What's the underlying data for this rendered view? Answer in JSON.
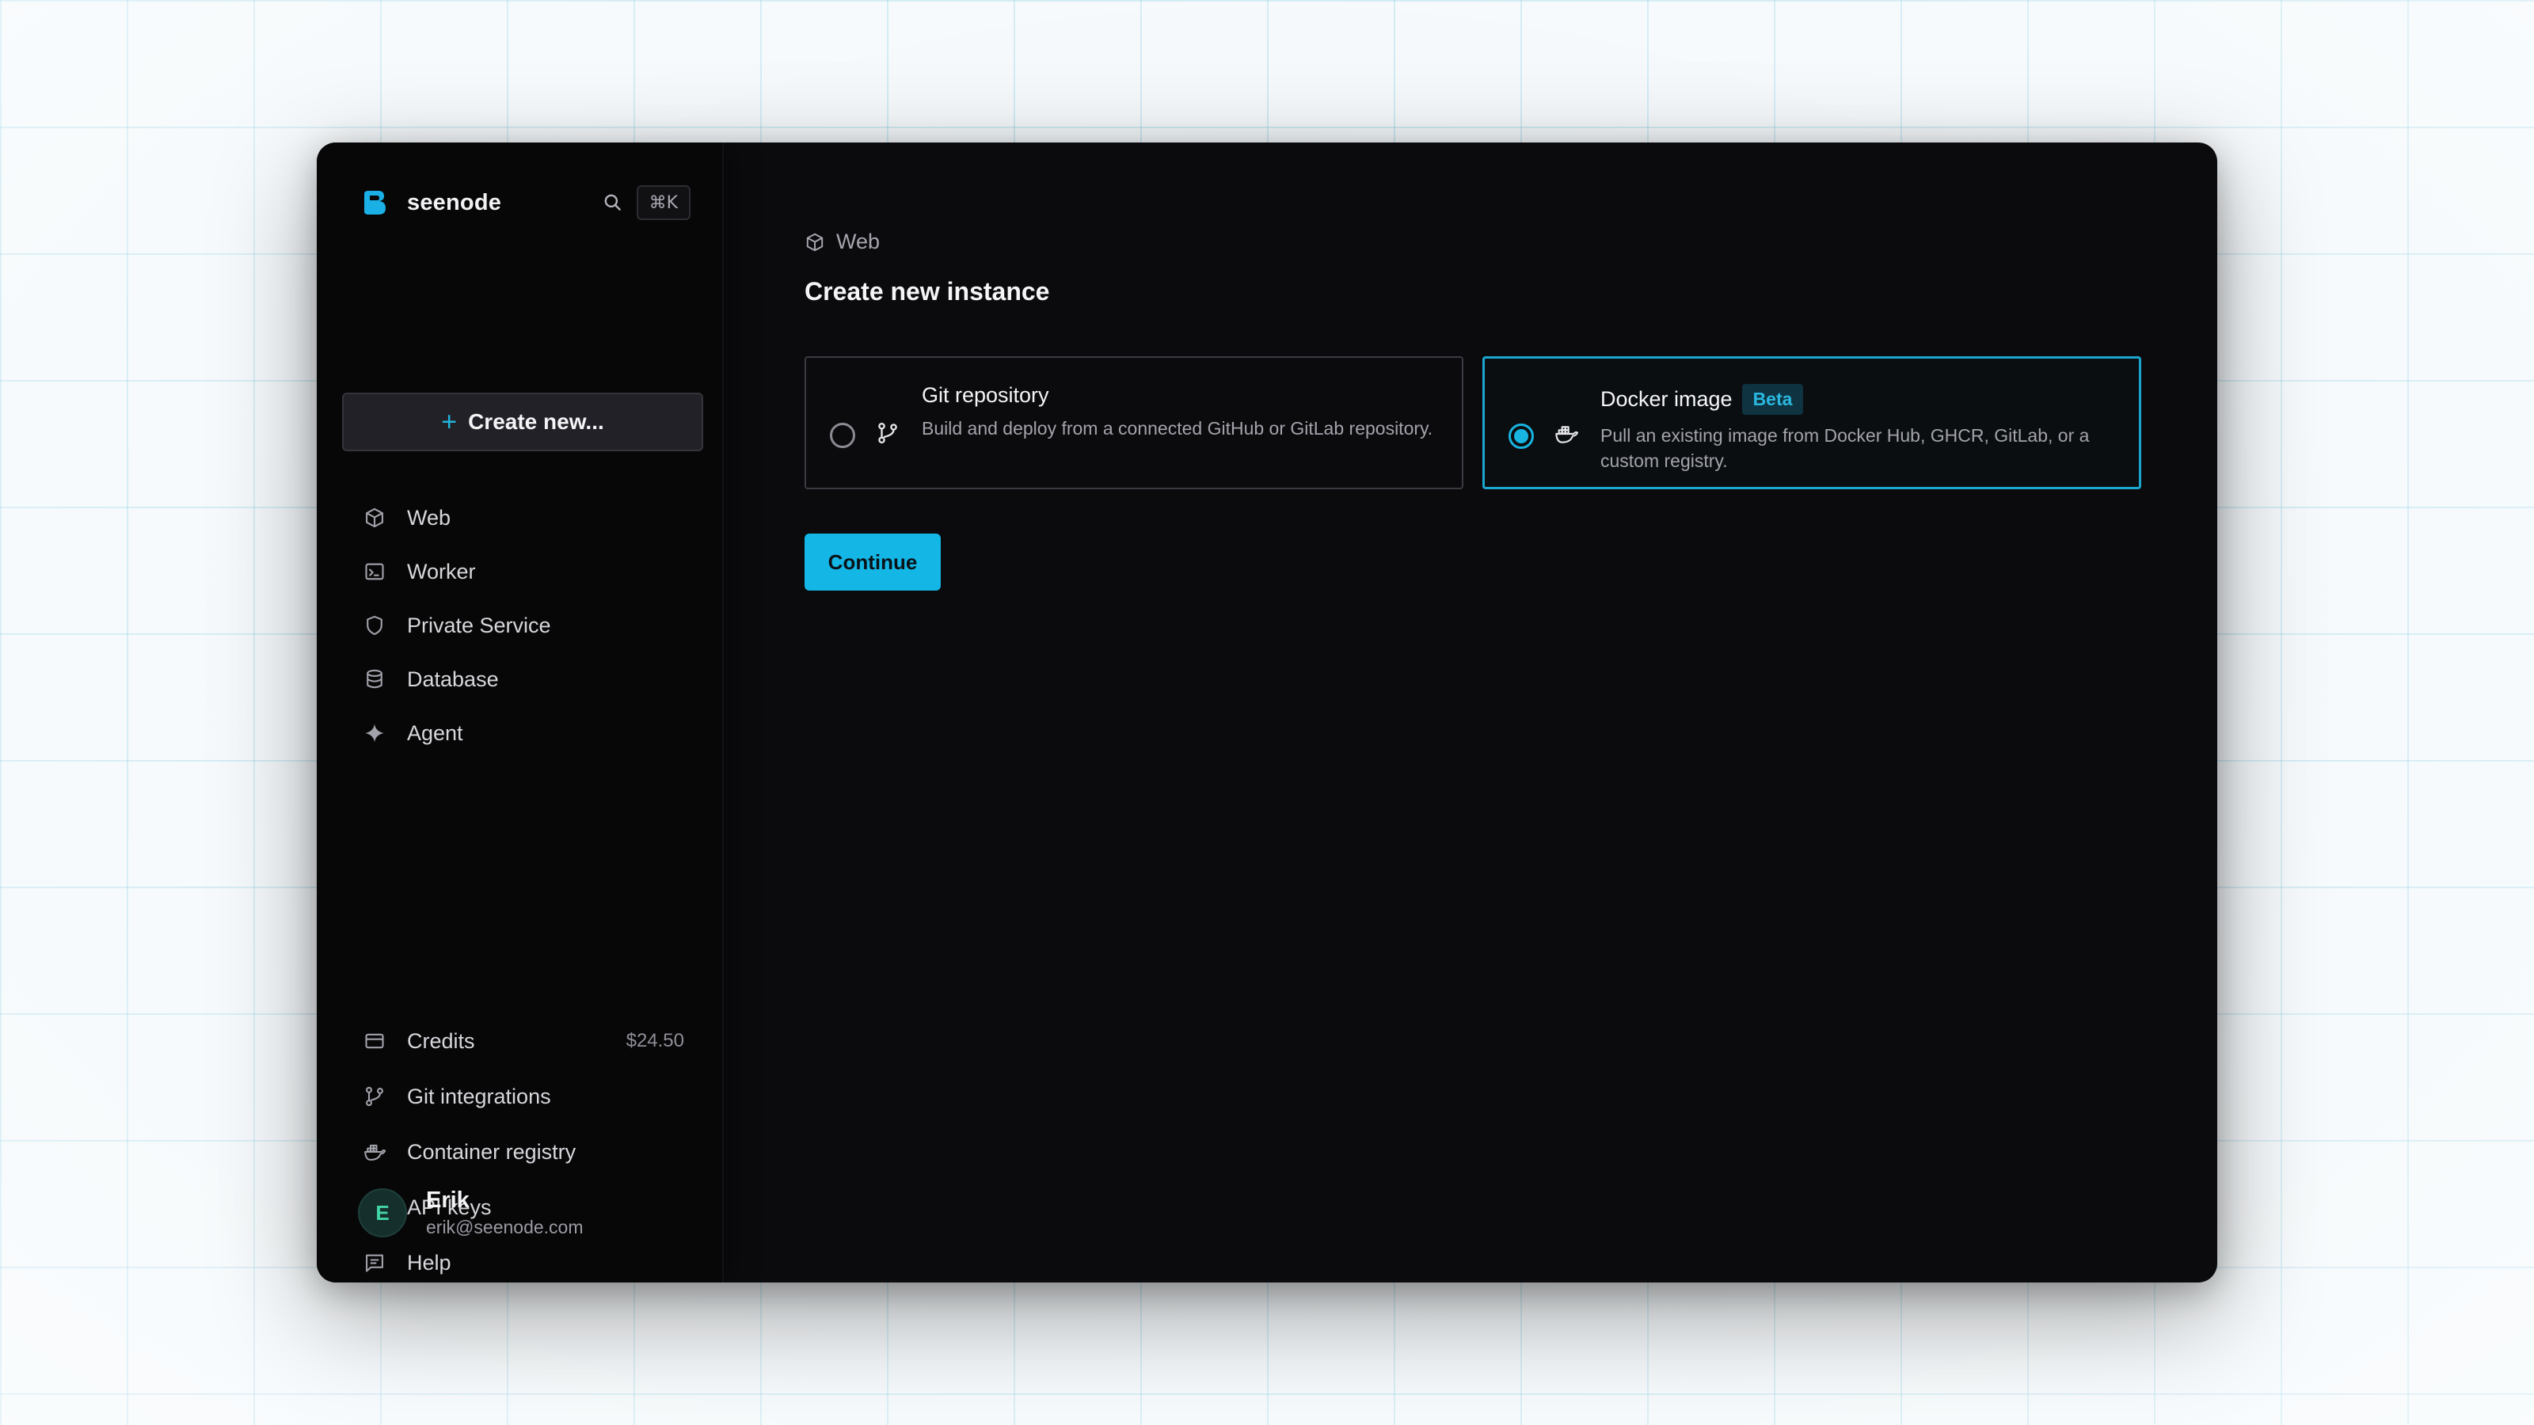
{
  "brand": {
    "name": "seenode",
    "shortcut": "⌘K"
  },
  "sidebar": {
    "create_label": "Create new...",
    "create_icon": "+",
    "items": [
      {
        "label": "Web",
        "icon": "cube-icon"
      },
      {
        "label": "Worker",
        "icon": "terminal-icon"
      },
      {
        "label": "Private Service",
        "icon": "shield-icon"
      },
      {
        "label": "Database",
        "icon": "database-icon"
      },
      {
        "label": "Agent",
        "icon": "sparkle-icon"
      }
    ],
    "bottom_items": [
      {
        "label": "Credits",
        "meta": "$24.50",
        "icon": "credit-card-icon"
      },
      {
        "label": "Git integrations",
        "icon": "git-branch-icon"
      },
      {
        "label": "Container registry",
        "icon": "docker-icon"
      },
      {
        "label": "API keys",
        "icon": "key-icon"
      },
      {
        "label": "Help",
        "icon": "message-icon"
      }
    ]
  },
  "user": {
    "initial": "E",
    "name": "Erik",
    "email": "erik@seenode.com"
  },
  "main": {
    "breadcrumb": "Web",
    "title": "Create new instance",
    "options": [
      {
        "title": "Git repository",
        "description": "Build and deploy from a connected GitHub or GitLab repository.",
        "selected": false
      },
      {
        "title": "Docker image",
        "badge": "Beta",
        "description": "Pull an existing image from Docker Hub, GHCR, GitLab, or a custom registry.",
        "selected": true
      }
    ],
    "continue_label": "Continue"
  },
  "colors": {
    "accent": "#14b6e6",
    "background": "#0b0b0e",
    "sidebar": "#070708",
    "avatar_text": "#42d5a6"
  }
}
